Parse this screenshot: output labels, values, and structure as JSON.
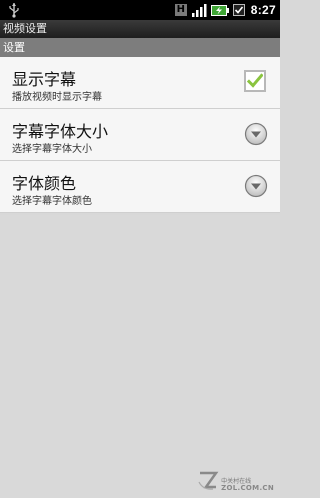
{
  "status_bar": {
    "network_type": "H",
    "time": "8:27",
    "icons": [
      "usb-icon",
      "signal-icon",
      "battery-charging-icon",
      "check-icon"
    ]
  },
  "window": {
    "title": "视频设置"
  },
  "section": {
    "header": "设置"
  },
  "settings": [
    {
      "title": "显示字幕",
      "summary": "播放视频时显示字幕",
      "control": "checkbox",
      "checked": true
    },
    {
      "title": "字幕字体大小",
      "summary": "选择字幕字体大小",
      "control": "dropdown"
    },
    {
      "title": "字体颜色",
      "summary": "选择字幕字体颜色",
      "control": "dropdown"
    }
  ],
  "watermark": {
    "brand_cn": "中关村在线",
    "brand_en": "ZOL.COM.CN",
    "logo_letter": "Z"
  },
  "colors": {
    "accent_check": "#8ac43f",
    "status_bar": "#000000",
    "section_header": "#7d7d7d"
  }
}
